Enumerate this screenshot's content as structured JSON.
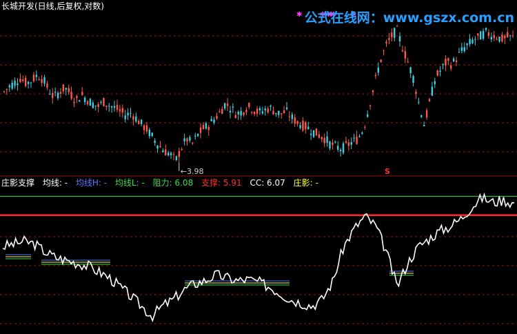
{
  "header": {
    "title": "长城开发(日线,后复权,对数)",
    "watermark": "公式在线网：www.gszx.com.cn",
    "low_label": "3.98",
    "signal_label": "S"
  },
  "legend": {
    "items": [
      {
        "key": "zhuangying_support",
        "text": "庄影支撑",
        "color": "#ffffff"
      },
      {
        "key": "junxian",
        "text": "均线: -",
        "color": "#ffffff"
      },
      {
        "key": "junxian_h",
        "text": "均线H: -",
        "color": "#5a78ff"
      },
      {
        "key": "junxian_l",
        "text": "均线L: -",
        "color": "#3ddc4a"
      },
      {
        "key": "resistance",
        "text": "阻力: 6.08",
        "color": "#3ddc4a"
      },
      {
        "key": "support",
        "text": "支撑: 5.91",
        "color": "#ff3030"
      },
      {
        "key": "cc",
        "text": "CC: 6.07",
        "color": "#ffffff"
      },
      {
        "key": "zhuangying",
        "text": "庄影: -",
        "color": "#ffff40"
      }
    ]
  },
  "colors": {
    "up": "#ff5a4a",
    "down": "#3fd0e0",
    "grid": "#a01010",
    "resistance": "#3ddc4a",
    "support": "#ff2828",
    "line": "#ffffff",
    "signal": "#ff40ff"
  },
  "chart_data": [
    {
      "type": "candlestick",
      "title": "长城开发(日线,后复权,对数)",
      "y_scale": "log",
      "annotations": [
        {
          "text": "3.98",
          "kind": "period-low"
        },
        {
          "text": "S",
          "kind": "sell-signal"
        }
      ],
      "close_path": [
        5.05,
        5.15,
        5.22,
        5.3,
        5.2,
        5.25,
        5.35,
        5.28,
        5.1,
        4.95,
        5.05,
        5.12,
        5.02,
        4.9,
        5.0,
        4.92,
        4.85,
        4.8,
        4.88,
        4.82,
        4.78,
        4.72,
        4.66,
        4.7,
        4.6,
        4.5,
        4.42,
        4.3,
        4.2,
        4.12,
        4.08,
        3.98,
        4.15,
        4.3,
        4.22,
        4.35,
        4.45,
        4.5,
        4.6,
        4.7,
        4.85,
        4.78,
        4.68,
        4.72,
        4.8,
        4.76,
        4.7,
        4.74,
        4.78,
        4.72,
        4.68,
        4.72,
        4.62,
        4.55,
        4.5,
        4.46,
        4.4,
        4.35,
        4.3,
        4.22,
        4.18,
        4.15,
        4.2,
        4.25,
        4.3,
        4.45,
        4.8,
        5.2,
        5.6,
        5.9,
        6.1,
        6.25,
        5.9,
        5.6,
        5.3,
        4.85,
        4.5,
        4.9,
        5.3,
        5.45,
        5.6,
        5.55,
        5.7,
        5.85,
        5.95,
        6.05,
        6.1,
        6.2,
        6.15,
        6.12,
        6.05,
        6.1,
        6.08
      ],
      "signal_markers_count": 6
    },
    {
      "type": "line",
      "title": "庄影支撑",
      "series": [
        {
          "name": "CC",
          "values": [
            5.2,
            5.25,
            5.3,
            5.25,
            5.1,
            5.0,
            4.95,
            4.9,
            4.85,
            4.75,
            4.65,
            4.5,
            4.35,
            4.2,
            4.05,
            4.2,
            4.3,
            4.45,
            4.55,
            4.6,
            4.7,
            4.65,
            4.6,
            4.62,
            4.58,
            4.5,
            4.4,
            4.3,
            4.25,
            4.2,
            4.3,
            4.6,
            5.2,
            5.55,
            5.8,
            5.6,
            5.1,
            4.5,
            4.9,
            5.2,
            5.35,
            5.5,
            5.6,
            5.75,
            6.0,
            6.2,
            6.1,
            6.15,
            6.07
          ]
        },
        {
          "name": "阻力",
          "values": [
            6.08
          ]
        },
        {
          "name": "支撑",
          "values": [
            5.91
          ]
        }
      ]
    }
  ]
}
